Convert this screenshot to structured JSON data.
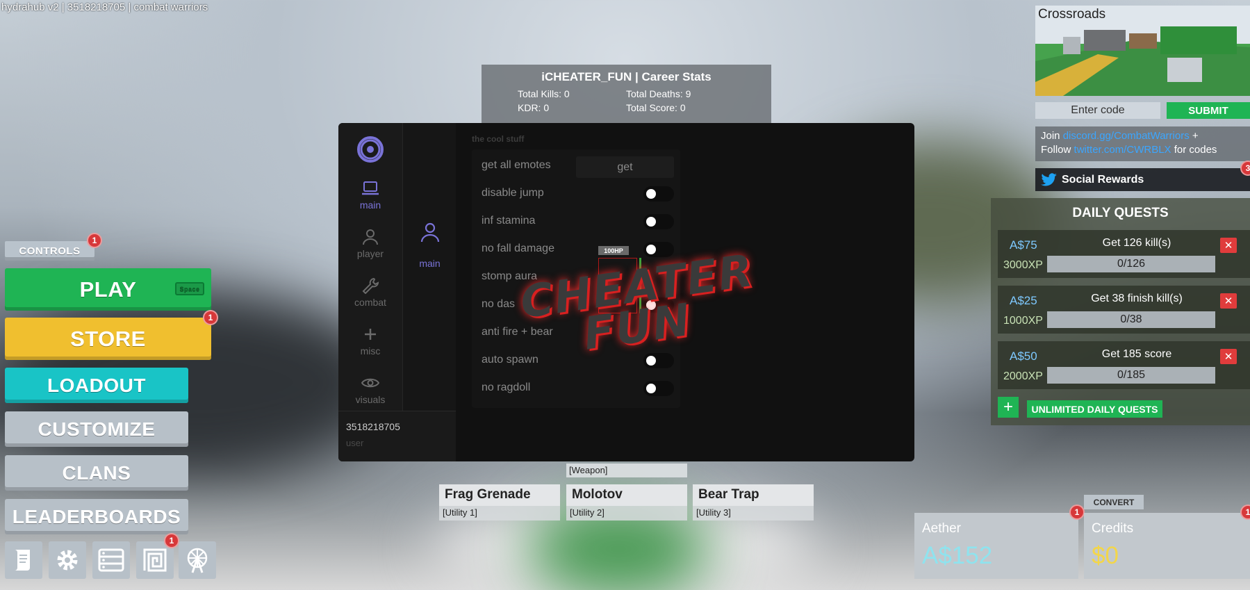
{
  "window_title": "hydrahub v2 | 3518218705 | combat warriors",
  "left_menu": {
    "controls": "CONTROLS",
    "controls_badge": "1",
    "play": "PLAY",
    "play_key": "Space",
    "store": "STORE",
    "store_badge": "1",
    "loadout": "LOADOUT",
    "customize": "CUSTOMIZE",
    "clans": "CLANS",
    "leaderboards": "LEADERBOARDS",
    "icons": [
      "scroll-icon",
      "gear-icon",
      "server-list-icon",
      "maze-icon",
      "ferris-wheel-icon"
    ],
    "maze_badge": "1"
  },
  "career": {
    "title": "iCHEATER_FUN | Career Stats",
    "kills": "Total Kills: 0",
    "deaths": "Total Deaths: 9",
    "kdr": "KDR: 0",
    "score": "Total Score: 0"
  },
  "cheat_panel": {
    "nav": [
      "main",
      "player",
      "combat",
      "misc",
      "visuals"
    ],
    "subnav": "main",
    "section": "the cool stuff",
    "options": [
      "get all emotes",
      "disable jump",
      "inf stamina",
      "no fall damage",
      "stomp aura",
      "no das",
      "anti fire + bear",
      "auto spawn",
      "no ragdoll"
    ],
    "get_label": "get",
    "user_id": "3518218705",
    "user_role": "user",
    "hp_tag": "100HP",
    "accent": "#7a73d8"
  },
  "watermark": {
    "line1": "CHEATER",
    "line2": "FUN"
  },
  "slots": {
    "weapon_tag": "[Weapon]",
    "items": [
      {
        "name": "Frag Grenade",
        "type": "[Utility 1]"
      },
      {
        "name": "Molotov",
        "type": "[Utility 2]"
      },
      {
        "name": "Bear Trap",
        "type": "[Utility 3]"
      }
    ]
  },
  "right": {
    "map_name": "Crossroads",
    "code_placeholder": "Enter code",
    "submit": "SUBMIT",
    "join_prefix": "Join",
    "discord": "discord.gg/CombatWarriors",
    "plus": "+",
    "follow": "Follow",
    "twitter": "twitter.com/CWRBLX",
    "for_codes": "for codes",
    "social": "Social Rewards",
    "social_badge": "3",
    "quests_title": "DAILY QUESTS",
    "quests": [
      {
        "reward": "A$75",
        "xp": "3000XP",
        "task": "Get 126 kill(s)",
        "progress": "0/126"
      },
      {
        "reward": "A$25",
        "xp": "1000XP",
        "task": "Get 38 finish kill(s)",
        "progress": "0/38"
      },
      {
        "reward": "A$50",
        "xp": "2000XP",
        "task": "Get 185 score",
        "progress": "0/185"
      }
    ],
    "unlimited": "UNLIMITED DAILY QUESTS",
    "convert": "CONVERT",
    "aether_label": "Aether",
    "aether_value": "A$152",
    "credits_label": "Credits",
    "credits_value": "$0",
    "badge": "1"
  }
}
